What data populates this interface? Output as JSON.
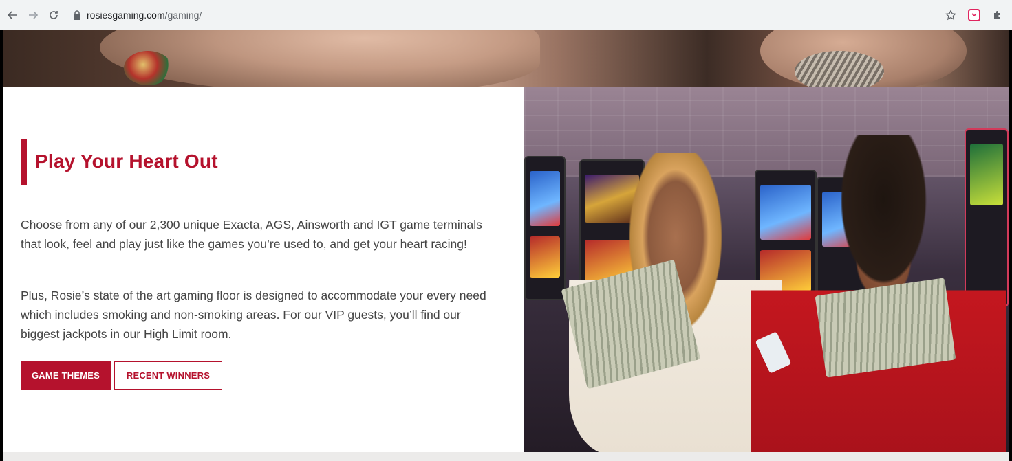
{
  "browser": {
    "url_host": "rosiesgaming.com",
    "url_path": "/gaming/"
  },
  "content": {
    "heading": "Play Your Heart Out",
    "paragraph_1": "Choose from any of our 2,300 unique Exacta, AGS, Ainsworth and IGT game terminals that look, feel and play just like the games you’re used to, and get your heart racing!",
    "paragraph_2": "Plus, Rosie’s state of the art gaming floor is designed to accommodate your every need which includes smoking and non-smoking areas. For our VIP guests, you’ll find our biggest jackpots in our High Limit room.",
    "buttons": [
      {
        "label": "GAME THEMES"
      },
      {
        "label": "RECENT WINNERS"
      }
    ]
  },
  "icons": [
    "back-arrow-icon",
    "forward-arrow-icon",
    "reload-icon",
    "lock-icon",
    "star-icon",
    "pocket-extension-icon",
    "puzzle-extension-icon"
  ],
  "colors": {
    "brand": "#b5122d",
    "text": "#444444"
  }
}
